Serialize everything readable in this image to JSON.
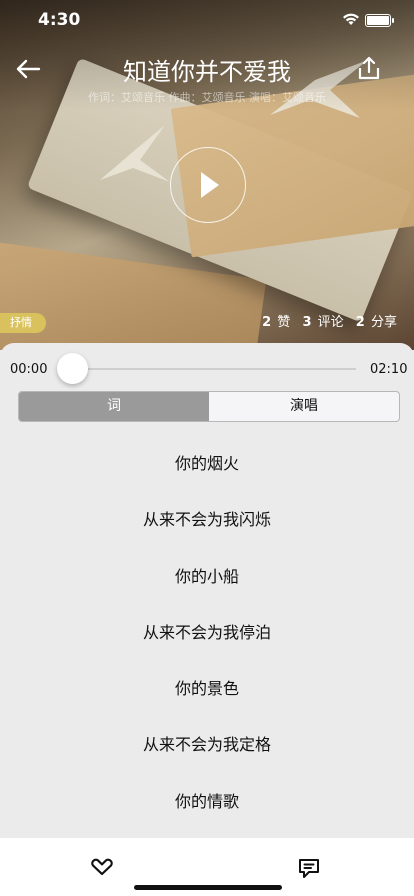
{
  "status": {
    "time": "4:30"
  },
  "header": {
    "title": "知道你并不爱我",
    "credits": "作词：艾颂音乐  作曲：艾颂音乐  演唱：艾颂音乐"
  },
  "tag": "抒情",
  "stats": {
    "likes_count": "2",
    "likes_label": "赞",
    "comments_count": "3",
    "comments_label": "评论",
    "shares_count": "2",
    "shares_label": "分享"
  },
  "player": {
    "current_time": "00:00",
    "total_time": "02:10",
    "progress": 0
  },
  "segments": {
    "lyrics_label": "词",
    "performance_label": "演唱",
    "selected": "词"
  },
  "lyrics": [
    "你的烟火",
    "从来不会为我闪烁",
    "你的小船",
    "从来不会为我停泊",
    "你的景色",
    "从来不会为我定格",
    "你的情歌"
  ],
  "icons": {
    "back": "arrow-left-icon",
    "share": "share-icon",
    "play": "play-icon",
    "like": "heart-outline-icon",
    "comment": "comment-icon"
  },
  "colors": {
    "tag": "#d9c25e",
    "segment_active": "#9a9a9a",
    "background": "#ebebeb"
  }
}
